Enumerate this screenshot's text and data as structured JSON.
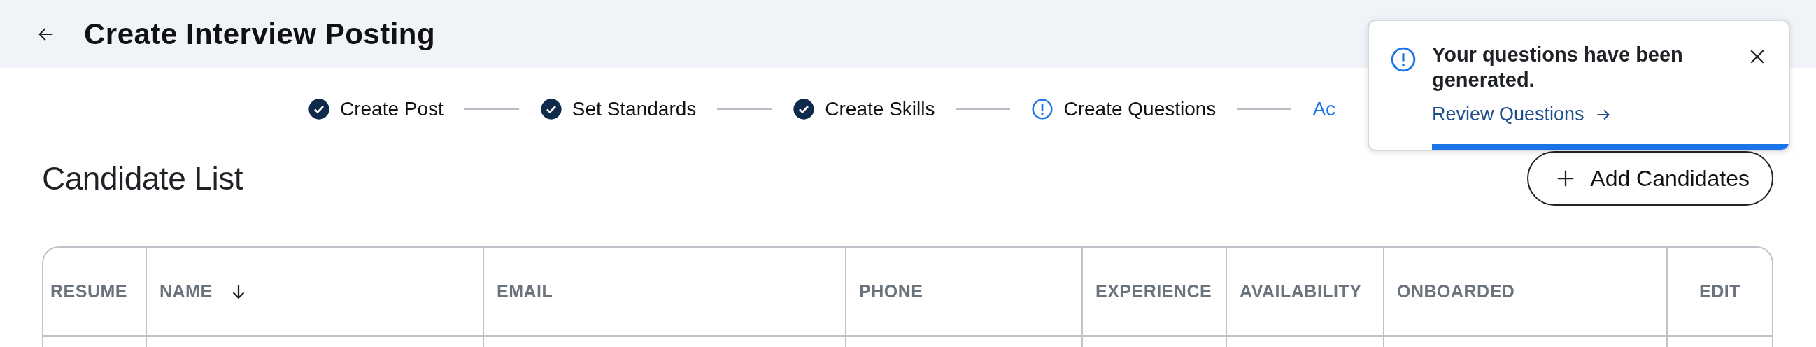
{
  "header": {
    "title": "Create Interview Posting"
  },
  "steps": [
    {
      "label": "Create Post",
      "kind": "done"
    },
    {
      "label": "Set Standards",
      "kind": "done"
    },
    {
      "label": "Create Skills",
      "kind": "done"
    },
    {
      "label": "Create Questions",
      "kind": "warning"
    },
    {
      "label": "Ac",
      "kind": "next"
    }
  ],
  "section": {
    "title": "Candidate List",
    "add_button": "Add Candidates"
  },
  "table": {
    "columns": [
      {
        "label": "RESUME",
        "sorted": false
      },
      {
        "label": "NAME",
        "sorted": true
      },
      {
        "label": "EMAIL",
        "sorted": false
      },
      {
        "label": "PHONE",
        "sorted": false
      },
      {
        "label": "EXPERIENCE",
        "sorted": false
      },
      {
        "label": "AVAILABILITY",
        "sorted": false
      },
      {
        "label": "ONBOARDED",
        "sorted": false
      },
      {
        "label": "EDIT",
        "sorted": false
      }
    ]
  },
  "toast": {
    "message": "Your questions have been generated.",
    "link": "Review Questions",
    "level": 0.85
  }
}
